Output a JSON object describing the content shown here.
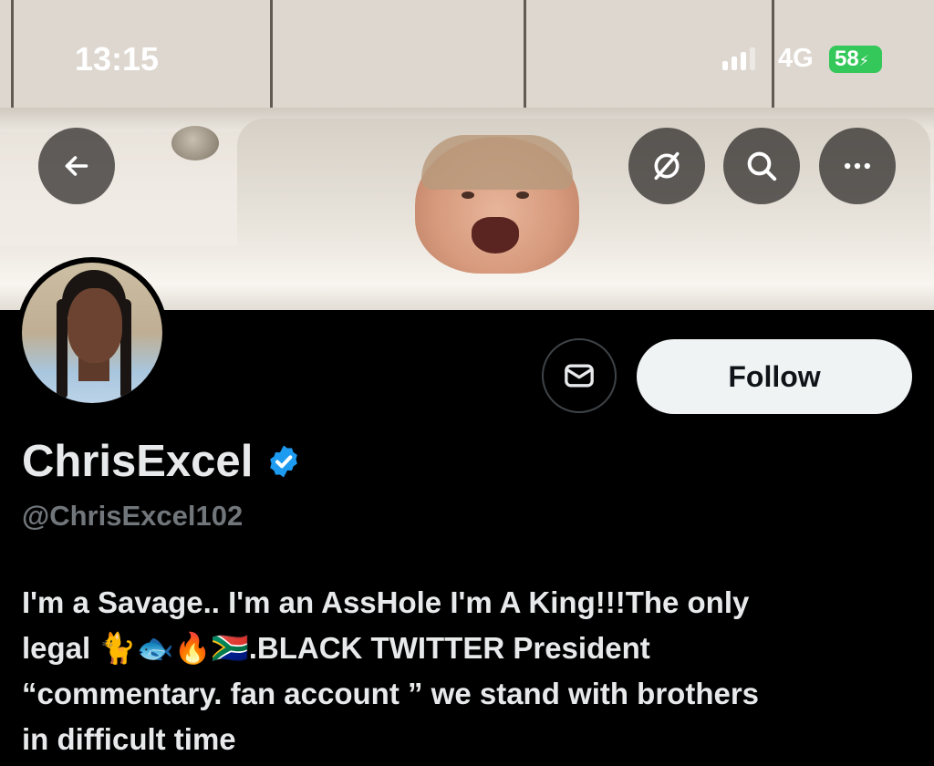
{
  "status_bar": {
    "time": "13:15",
    "network": "4G",
    "battery": "58"
  },
  "header": {
    "back_icon": "arrow-left-icon",
    "grok_icon": "circle-slash-icon",
    "search_icon": "search-icon",
    "more_icon": "more-horizontal-icon"
  },
  "profile": {
    "display_name": "ChrisExcel",
    "handle": "@ChrisExcel102",
    "verified": true,
    "bio": "I'm a Savage.. I'm an AssHole I'm A King!!!The only\nlegal 🐈🐟🔥🇿🇦.BLACK TWITTER President\n“commentary. fan account ” we stand with brothers\nin difficult time"
  },
  "actions": {
    "message_icon": "envelope-icon",
    "follow_label": "Follow"
  },
  "colors": {
    "background": "#000000",
    "text_primary": "#e7e9ea",
    "text_secondary": "#71767b",
    "verified_blue": "#1d9bf0",
    "follow_bg": "#eff3f4",
    "battery_green": "#34c759"
  }
}
